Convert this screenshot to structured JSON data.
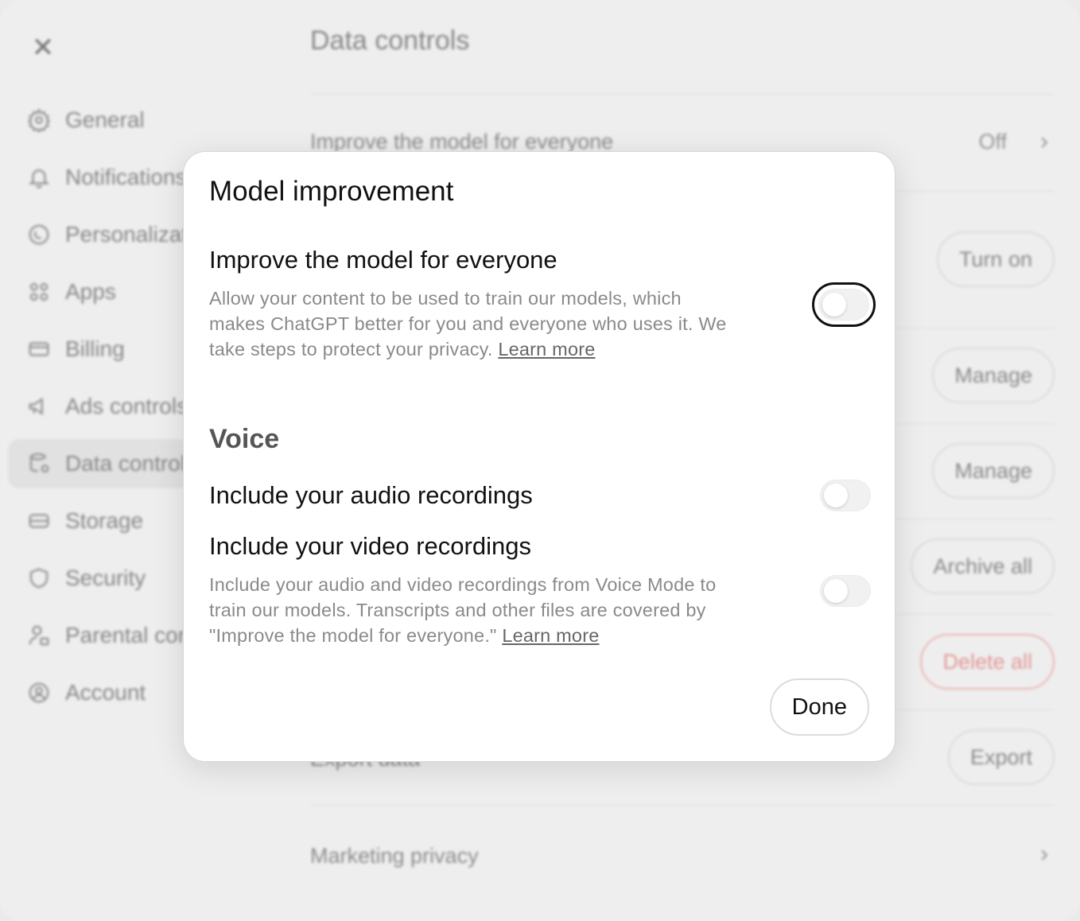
{
  "background": {
    "page_title": "Data controls",
    "sidebar": {
      "items": [
        {
          "label": "General",
          "icon": "gear-icon"
        },
        {
          "label": "Notifications",
          "icon": "bell-icon"
        },
        {
          "label": "Personalization",
          "icon": "personalization-icon"
        },
        {
          "label": "Apps",
          "icon": "apps-grid-icon"
        },
        {
          "label": "Billing",
          "icon": "credit-card-icon"
        },
        {
          "label": "Ads controls",
          "icon": "megaphone-icon"
        },
        {
          "label": "Data controls",
          "icon": "database-icon",
          "active": true
        },
        {
          "label": "Storage",
          "icon": "storage-icon"
        },
        {
          "label": "Security",
          "icon": "shield-icon"
        },
        {
          "label": "Parental controls",
          "icon": "parental-icon"
        },
        {
          "label": "Account",
          "icon": "account-icon"
        }
      ]
    },
    "rows": {
      "improve_model_label": "Improve the model for everyone",
      "improve_model_value": "Off",
      "turn_on_label": "Turn on",
      "manage_label_1": "Manage",
      "manage_label_2": "Manage",
      "archive_all_label": "Archive all",
      "delete_all_label": "Delete all",
      "export_data_label": "Export data",
      "export_label": "Export",
      "marketing_privacy_label": "Marketing privacy"
    }
  },
  "modal": {
    "title": "Model improvement",
    "improve": {
      "title": "Improve the model for everyone",
      "description": "Allow your content to be used to train our models, which makes ChatGPT better for you and everyone who uses it. We take steps to protect your privacy.",
      "link": "Learn more",
      "enabled": false
    },
    "voice": {
      "heading": "Voice",
      "audio_title": "Include your audio recordings",
      "audio_enabled": false,
      "video_title": "Include your video recordings",
      "video_enabled": false,
      "description": "Include your audio and video recordings from Voice Mode to train our models. Transcripts and other files are covered by \"Improve the model for everyone.\"",
      "link": "Learn more"
    },
    "done_label": "Done"
  }
}
